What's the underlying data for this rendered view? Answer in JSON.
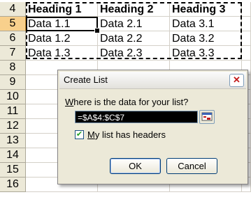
{
  "sheet": {
    "rows": [
      {
        "num": "4",
        "cells": [
          "Heading 1",
          "Heading 2",
          "Heading 3"
        ]
      },
      {
        "num": "5",
        "cells": [
          "Data 1.1",
          "Data 2.1",
          "Data 3.1"
        ]
      },
      {
        "num": "6",
        "cells": [
          "Data 1.2",
          "Data 2.2",
          "Data 3.2"
        ]
      },
      {
        "num": "7",
        "cells": [
          "Data 1.3",
          "Data 2.3",
          "Data 3.3"
        ]
      },
      {
        "num": "8",
        "cells": [
          "",
          "",
          ""
        ]
      },
      {
        "num": "9",
        "cells": [
          "",
          "",
          ""
        ]
      },
      {
        "num": "10",
        "cells": [
          "",
          "",
          ""
        ]
      },
      {
        "num": "11",
        "cells": [
          "",
          "",
          ""
        ]
      },
      {
        "num": "12",
        "cells": [
          "",
          "",
          ""
        ]
      },
      {
        "num": "13",
        "cells": [
          "",
          "",
          ""
        ]
      },
      {
        "num": "14",
        "cells": [
          "",
          "",
          ""
        ]
      },
      {
        "num": "15",
        "cells": [
          "",
          "",
          ""
        ]
      },
      {
        "num": "16",
        "cells": [
          "",
          "",
          ""
        ]
      }
    ],
    "selected_row": "5"
  },
  "dialog": {
    "title": "Create List",
    "close_glyph": "✕",
    "prompt": "Where is the data for your list?",
    "prompt_hotkey": "W",
    "prompt_rest": "here is the data for your list?",
    "range_value": "=$A$4:$C$7",
    "checkbox_checked": true,
    "checkbox_mark": "✔",
    "checkbox_label_hotkey": "M",
    "checkbox_label_rest": "y list has headers",
    "ok_label": "OK",
    "cancel_label": "Cancel"
  },
  "colors": {
    "row_header": "#ece9d8",
    "row_header_selected": "#f8d08c",
    "dialog_bg": "#ece9d8",
    "range_field_bg": "#000000"
  },
  "icons": {
    "collapse_dialog": "collapse-dialog-icon",
    "close": "close-icon"
  }
}
